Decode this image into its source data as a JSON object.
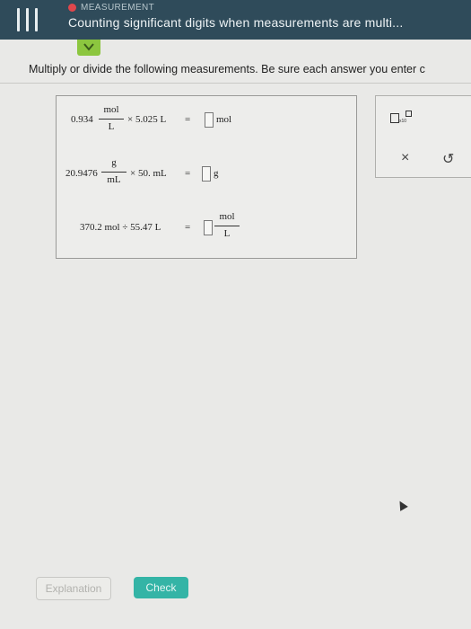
{
  "header": {
    "topic": "MEASUREMENT",
    "title": "Counting significant digits when measurements are multi..."
  },
  "instruction": "Multiply or divide the following measurements. Be sure each answer you enter c",
  "problems": [
    {
      "left": "0.934",
      "num": "mol",
      "den": "L",
      "op": "× 5.025 L",
      "eq": "=",
      "unit": "mol"
    },
    {
      "left": "20.9476",
      "num": "g",
      "den": "mL",
      "op": "× 50. mL",
      "eq": "=",
      "unit": "g"
    },
    {
      "expr": "370.2 mol ÷ 55.47 L",
      "eq": "=",
      "unit_num": "mol",
      "unit_den": "L"
    }
  ],
  "tools": {
    "x10_label": "x10",
    "clear": "×",
    "undo": "↺"
  },
  "buttons": {
    "explanation": "Explanation",
    "check": "Check"
  },
  "colors": {
    "header": "#2f4b5a",
    "accent_green": "#8cc63f",
    "check_teal": "#34b4a6",
    "topic_dot": "#e0474c"
  }
}
